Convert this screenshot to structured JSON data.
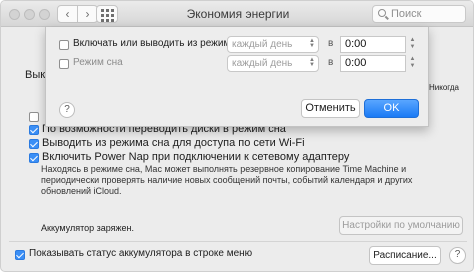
{
  "window": {
    "title": "Экономия энергии",
    "search_placeholder": "Поиск",
    "back_symbol": "‹",
    "forward_symbol": "›"
  },
  "background": {
    "sleep_label_partial": "Выкл",
    "slider_end_label": "Никогда",
    "options": [
      {
        "label": "",
        "checked": false
      },
      {
        "label": "По возможности переводить диски в режим сна",
        "checked": true
      },
      {
        "label": "Выводить из режима сна для доступа по сети Wi-Fi",
        "checked": true
      },
      {
        "label": "Включить Power Nap при подключении к сетевому адаптеру",
        "checked": true
      }
    ],
    "power_nap_description": "Находясь в режиме сна, Mac может выполнять резервное копирование Time Machine и периодически проверять наличие новых сообщений почты, событий календаря и других обновлений iCloud.",
    "battery_status": "Аккумулятор заряжен.",
    "defaults_button": "Настройки по умолчанию",
    "show_battery_label": "Показывать статус аккумулятора в строке меню",
    "show_battery_checked": true,
    "schedule_button": "Расписание..."
  },
  "sheet": {
    "rows": [
      {
        "label": "Включать или выводить из режима сна",
        "checked": false,
        "day": "каждый день",
        "at": "в",
        "time": "0:00"
      },
      {
        "label": "Режим сна",
        "checked": false,
        "day": "каждый день",
        "at": "в",
        "time": "0:00"
      }
    ],
    "help": "?",
    "cancel": "Отменить",
    "ok": "OK"
  },
  "colors": {
    "accent": "#1a7af5",
    "checkbox_on": "#3b8ff6"
  }
}
